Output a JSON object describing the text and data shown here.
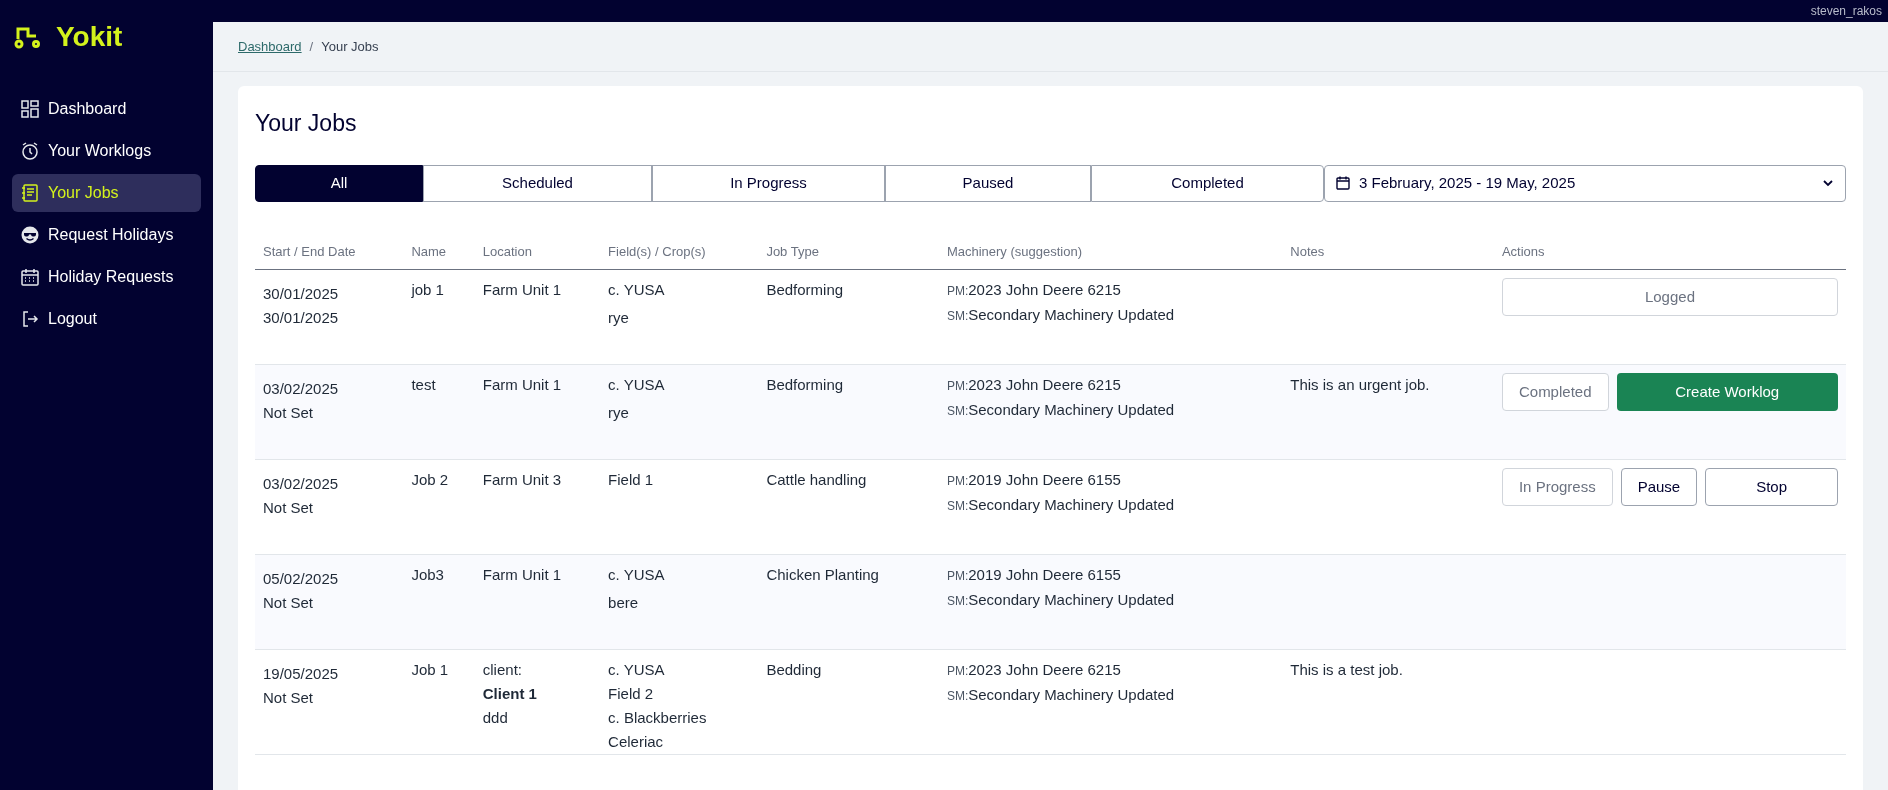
{
  "brand": "Yokit",
  "user": "steven_rakos",
  "sidebar": {
    "items": [
      {
        "label": "Dashboard",
        "kind": "grid",
        "selected": false
      },
      {
        "label": "Your Worklogs",
        "kind": "clock",
        "selected": false
      },
      {
        "label": "Your Jobs",
        "kind": "list",
        "selected": true
      },
      {
        "label": "Request Holidays",
        "kind": "smile",
        "selected": false
      },
      {
        "label": "Holiday Requests",
        "kind": "calendar",
        "selected": false
      },
      {
        "label": "Logout",
        "kind": "logout",
        "selected": false
      }
    ]
  },
  "breadcrumb": [
    {
      "label": "Dashboard",
      "link": true
    },
    {
      "label": "Your Jobs",
      "link": false
    }
  ],
  "breadcrumb_separator": "/",
  "title": "Your Jobs",
  "tabs": [
    {
      "label": "All",
      "selected": true
    },
    {
      "label": "Scheduled",
      "selected": false
    },
    {
      "label": "In Progress",
      "selected": false
    },
    {
      "label": "Paused",
      "selected": false
    },
    {
      "label": "Completed",
      "selected": false
    }
  ],
  "date_range": {
    "value": "3 February, 2025 - 19 May, 2025"
  },
  "table": {
    "columns": [
      "Start / End Date",
      "Name",
      "Location",
      "Field(s) / Crop(s)",
      "Job Type",
      "Machinery (suggestion)",
      "Notes",
      "Actions"
    ],
    "rows": [
      {
        "dates": [
          "30/01/2025",
          "30/01/2025"
        ],
        "name": "job 1",
        "location": [
          {
            "text": "Farm Unit 1",
            "bold": false
          }
        ],
        "fields": [
          "c. YUSA",
          "rye"
        ],
        "job_type": "Bedforming",
        "machinery": [
          {
            "prefix": "PM:",
            "text": "2023 John Deere 6215"
          },
          {
            "prefix": "SM:",
            "text": "Secondary Machinery Updated"
          }
        ],
        "notes": "",
        "actions": [
          {
            "label": "Logged",
            "kind": "status"
          }
        ]
      },
      {
        "dates": [
          "03/02/2025",
          "Not Set"
        ],
        "name": "test",
        "location": [
          {
            "text": "Farm Unit 1",
            "bold": false
          }
        ],
        "fields": [
          "c. YUSA",
          "rye"
        ],
        "job_type": "Bedforming",
        "machinery": [
          {
            "prefix": "PM:",
            "text": "2023 John Deere 6215"
          },
          {
            "prefix": "SM:",
            "text": "Secondary Machinery Updated"
          }
        ],
        "notes": "This is an urgent job.",
        "actions": [
          {
            "label": "Completed",
            "kind": "status"
          },
          {
            "label": "Create Worklog",
            "kind": "primary"
          }
        ]
      },
      {
        "dates": [
          "03/02/2025",
          "Not Set"
        ],
        "name": "Job 2",
        "location": [
          {
            "text": "Farm Unit 3",
            "bold": false
          }
        ],
        "fields": [
          "Field 1"
        ],
        "job_type": "Cattle handling",
        "machinery": [
          {
            "prefix": "PM:",
            "text": "2019 John Deere 6155"
          },
          {
            "prefix": "SM:",
            "text": "Secondary Machinery Updated"
          }
        ],
        "notes": "",
        "actions": [
          {
            "label": "In Progress",
            "kind": "status"
          },
          {
            "label": "Pause",
            "kind": "outline"
          },
          {
            "label": "Stop",
            "kind": "outline"
          }
        ]
      },
      {
        "dates": [
          "05/02/2025",
          "Not Set"
        ],
        "name": "Job3",
        "location": [
          {
            "text": "Farm Unit 1",
            "bold": false
          }
        ],
        "fields": [
          "c. YUSA",
          "bere"
        ],
        "job_type": "Chicken Planting",
        "machinery": [
          {
            "prefix": "PM:",
            "text": "2019 John Deere 6155"
          },
          {
            "prefix": "SM:",
            "text": "Secondary Machinery Updated"
          }
        ],
        "notes": "",
        "actions": []
      },
      {
        "dates": [
          "19/05/2025",
          "Not Set"
        ],
        "name": "Job 1",
        "location": [
          {
            "text": "client:",
            "bold": false
          },
          {
            "text": "Client 1",
            "bold": true
          },
          {
            "text": "ddd",
            "bold": false
          }
        ],
        "fields": [
          "c. YUSA",
          "Field 2",
          "c. Blackberries",
          "Celeriac"
        ],
        "job_type": "Bedding",
        "machinery": [
          {
            "prefix": "PM:",
            "text": "2023 John Deere 6215"
          },
          {
            "prefix": "SM:",
            "text": "Secondary Machinery Updated"
          }
        ],
        "notes": "This is a test job.",
        "actions": []
      }
    ]
  }
}
